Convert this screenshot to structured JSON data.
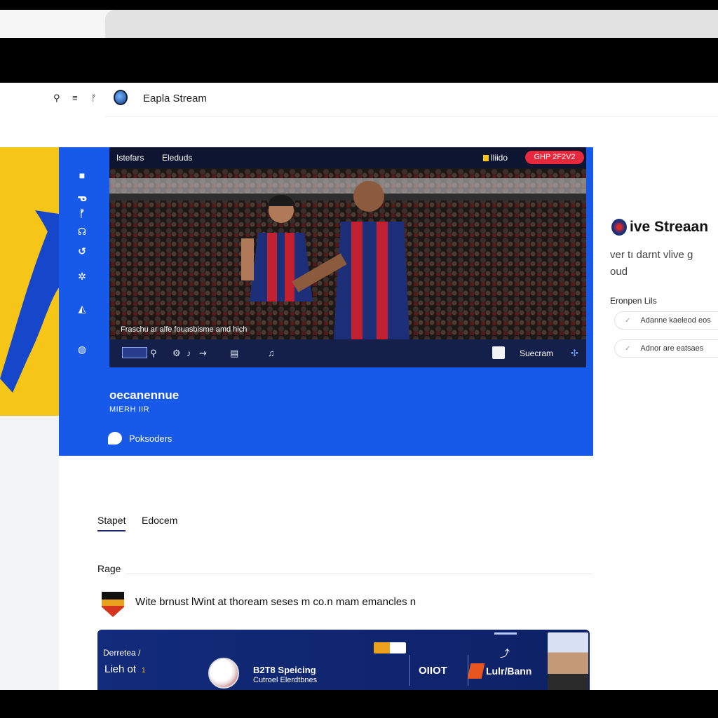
{
  "app": {
    "title": "Eapla Stream",
    "nav_icons": [
      "search-icon",
      "menu-icon",
      "flag-icon"
    ]
  },
  "player": {
    "tabs": [
      "Istefars",
      "Eleduds"
    ],
    "quality": "lliido",
    "live_button": "GHP 2F2V2",
    "caption": "Fraschu ar alfe fouasbisme amd hich",
    "controls": {
      "label": "Suecram"
    }
  },
  "stream": {
    "title": "oecanennue",
    "subtitle": "MIERH IIR",
    "subscribe_label": "Poksoders"
  },
  "right_panel": {
    "heading": "ive Streaan",
    "description_line1": "ver tı darnt vlive g",
    "description_line2": "oud",
    "options_label": "Eronpen Lils",
    "options": [
      "Adanne kaeleod eos",
      "Adnor are eatsaes"
    ]
  },
  "tabs": {
    "active": "Stapet",
    "second": "Edocem"
  },
  "section": {
    "label": "Rage",
    "match_text": "Wite brnust lWint at thoream seses m co.n mam emancles n"
  },
  "card": {
    "label1": "Derretea /",
    "label2": "Lieh ot",
    "label2_mark": "1",
    "title": "B2T8 Speicing",
    "subtitle": "Cutroel Elerdtbnes",
    "code": "OIIOT",
    "tag": "Lulr/Bann"
  },
  "colors": {
    "primary_blue": "#1759e8",
    "live_red": "#e8283c",
    "accent_yellow": "#f5c518",
    "card_navy": "#122b7a"
  }
}
